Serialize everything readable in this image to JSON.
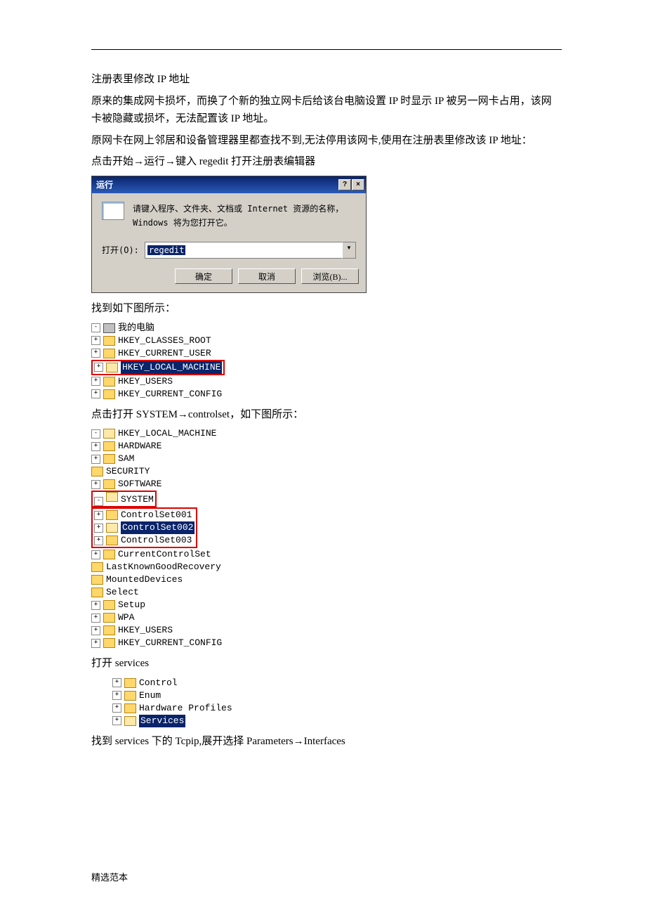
{
  "doc": {
    "title": "注册表里修改 IP 地址",
    "p1": "原来的集成网卡损坏，而换了个新的独立网卡后给该台电脑设置 IP 时显示 IP 被另一网卡占用，该网卡被隐藏或损坏，无法配置该 IP 地址。",
    "p2": "原网卡在网上邻居和设备管理器里都查找不到,无法停用该网卡,使用在注册表里修改该 IP 地址：",
    "p3": "点击开始→运行→键入 regedit 打开注册表编辑器",
    "heading2": "找到如下图所示：",
    "heading3": "点击打开 SYSTEM→controlset，如下图所示：",
    "heading4": "打开 services",
    "heading5": "找到 services 下的 Tcpip,展开选择 Parameters→Interfaces",
    "footer": "精选范本"
  },
  "runDialog": {
    "title": "运行",
    "desc": "请键入程序、文件夹、文档或 Internet 资源的名称，Windows 将为您打开它。",
    "openLabel": "打开(O):",
    "value": "regedit",
    "ok": "确定",
    "cancel": "取消",
    "browse": "浏览(B)..."
  },
  "tree1": {
    "root": "我的电脑",
    "items": [
      "HKEY_CLASSES_ROOT",
      "HKEY_CURRENT_USER",
      "HKEY_LOCAL_MACHINE",
      "HKEY_USERS",
      "HKEY_CURRENT_CONFIG"
    ]
  },
  "tree2": {
    "root": "HKEY_LOCAL_MACHINE",
    "lvl1": [
      "HARDWARE",
      "SAM",
      "SECURITY",
      "SOFTWARE",
      "SYSTEM"
    ],
    "systemChildren": [
      "ControlSet001",
      "ControlSet002",
      "ControlSet003",
      "CurrentControlSet",
      "LastKnownGoodRecovery",
      "MountedDevices",
      "Select",
      "Setup",
      "WPA"
    ],
    "after": [
      "HKEY_USERS",
      "HKEY_CURRENT_CONFIG"
    ]
  },
  "tree3": {
    "items": [
      "Control",
      "Enum",
      "Hardware Profiles",
      "Services"
    ]
  }
}
